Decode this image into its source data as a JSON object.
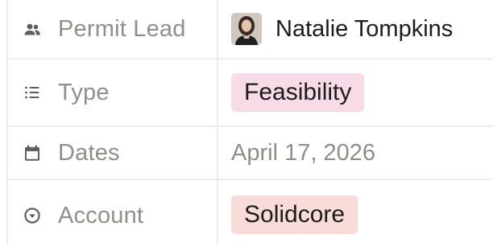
{
  "properties": [
    {
      "label": "Permit Lead",
      "icon": "people-icon",
      "value_type": "person",
      "value": "Natalie Tompkins"
    },
    {
      "label": "Type",
      "icon": "list-icon",
      "value_type": "select",
      "value": "Feasibility",
      "tag_color": "#f7dbe6"
    },
    {
      "label": "Dates",
      "icon": "calendar-icon",
      "value_type": "date",
      "value": "April 17, 2026"
    },
    {
      "label": "Account",
      "icon": "circle-chevron-down-icon",
      "value_type": "select",
      "value": "Solidcore",
      "tag_color": "#f9dcd9"
    }
  ]
}
